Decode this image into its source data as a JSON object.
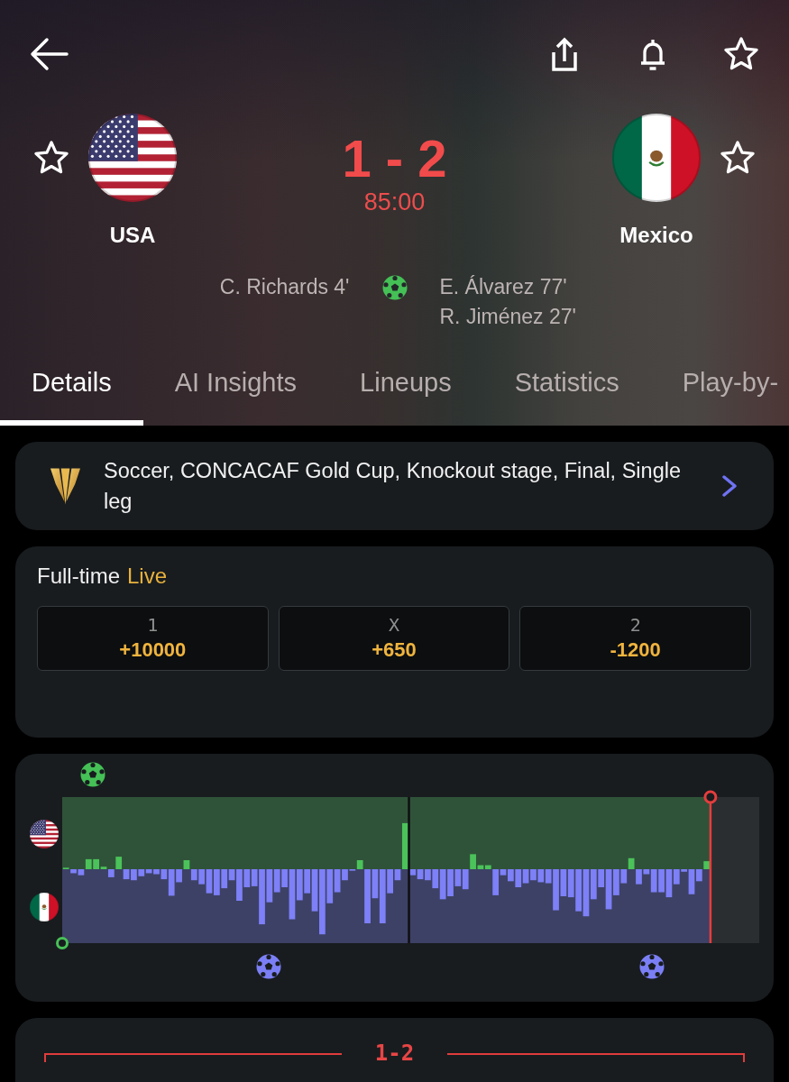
{
  "match": {
    "followed": false,
    "score": "1 - 2",
    "clock": "85:00",
    "home": {
      "name": "USA",
      "followed": false,
      "scorers": [
        "C. Richards 4'"
      ]
    },
    "away": {
      "name": "Mexico",
      "followed": false,
      "scorers": [
        "E. Álvarez 77'",
        "R. Jiménez 27'"
      ]
    }
  },
  "tabs": [
    {
      "label": "Details",
      "selected": true
    },
    {
      "label": "AI Insights",
      "selected": false
    },
    {
      "label": "Lineups",
      "selected": false
    },
    {
      "label": "Statistics",
      "selected": false
    },
    {
      "label": "Play-by-",
      "selected": false
    }
  ],
  "competition": {
    "text": "Soccer, CONCACAF Gold Cup, Knockout stage, Final, Single leg"
  },
  "market": {
    "title": "Full-time",
    "status": "Live",
    "options": [
      {
        "label": "1",
        "price": "+10000"
      },
      {
        "label": "X",
        "price": "+650"
      },
      {
        "label": "2",
        "price": "-1200"
      }
    ]
  },
  "momentum": {
    "level": 0.93
  },
  "summary": {
    "score": "1-2"
  }
}
